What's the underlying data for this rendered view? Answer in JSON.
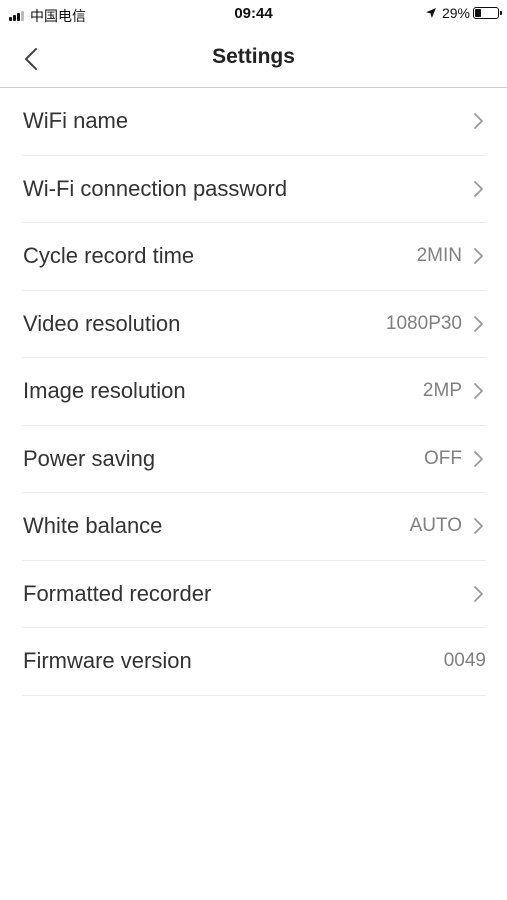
{
  "status_bar": {
    "carrier": "中国电信",
    "time": "09:44",
    "battery": "29%",
    "battery_level": 0.29,
    "icons": [
      "signal-icon",
      "location-arrow-icon",
      "battery-icon"
    ]
  },
  "header": {
    "title": "Settings",
    "back_icon": "chevron-left-icon"
  },
  "settings": {
    "items": [
      {
        "label": "WiFi name",
        "value": "",
        "chevron": true
      },
      {
        "label": "Wi-Fi connection password",
        "value": "",
        "chevron": true
      },
      {
        "label": "Cycle record time",
        "value": "2MIN",
        "chevron": true
      },
      {
        "label": "Video resolution",
        "value": "1080P30",
        "chevron": true
      },
      {
        "label": "Image resolution",
        "value": "2MP",
        "chevron": true
      },
      {
        "label": "Power saving",
        "value": "OFF",
        "chevron": true
      },
      {
        "label": "White balance",
        "value": "AUTO",
        "chevron": true
      },
      {
        "label": "Formatted recorder",
        "value": "",
        "chevron": true
      },
      {
        "label": "Firmware version",
        "value": "0049",
        "chevron": false
      }
    ]
  },
  "colors": {
    "text": "#333333",
    "value": "#808080",
    "divider": "#ececec",
    "background": "#ffffff"
  }
}
